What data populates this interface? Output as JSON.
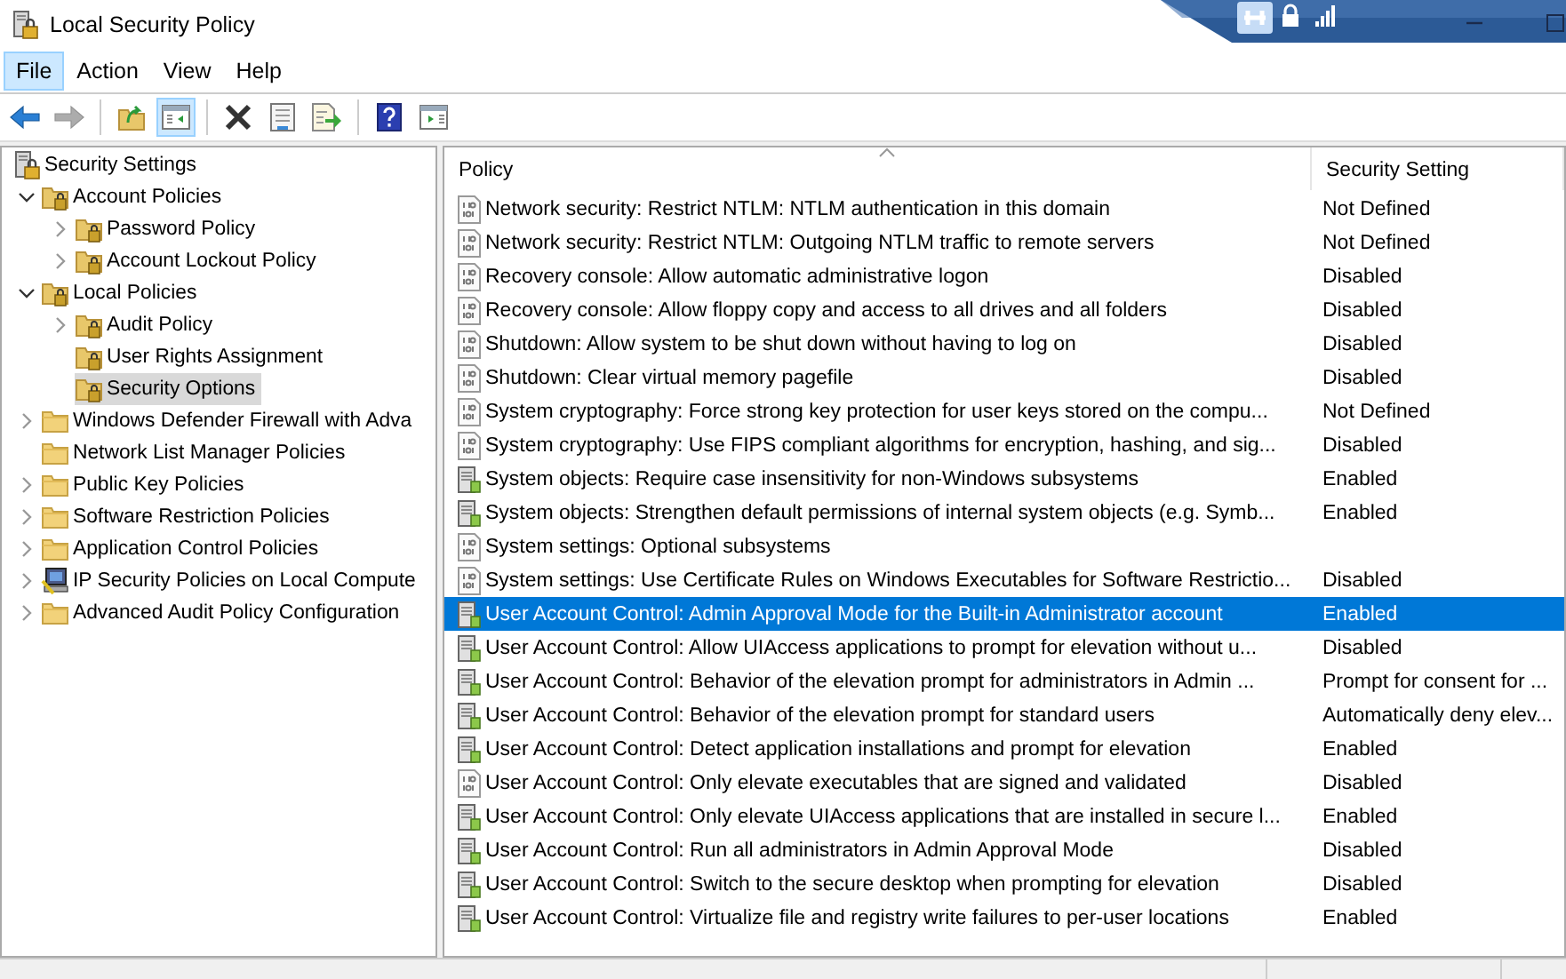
{
  "window": {
    "title": "Local Security Policy"
  },
  "menu": [
    {
      "label": "File",
      "selected": true
    },
    {
      "label": "Action",
      "selected": false
    },
    {
      "label": "View",
      "selected": false
    },
    {
      "label": "Help",
      "selected": false
    }
  ],
  "toolbar": [
    {
      "kind": "back",
      "disabled": false,
      "pressed": false
    },
    {
      "kind": "forward",
      "disabled": true,
      "pressed": false
    },
    {
      "kind": "separator"
    },
    {
      "kind": "up",
      "disabled": false,
      "pressed": false
    },
    {
      "kind": "tree",
      "disabled": false,
      "pressed": true
    },
    {
      "kind": "separator"
    },
    {
      "kind": "delete",
      "disabled": false,
      "pressed": false
    },
    {
      "kind": "properties",
      "disabled": false,
      "pressed": false
    },
    {
      "kind": "export",
      "disabled": false,
      "pressed": false
    },
    {
      "kind": "separator"
    },
    {
      "kind": "help",
      "disabled": false,
      "pressed": false
    },
    {
      "kind": "pane",
      "disabled": false,
      "pressed": false
    }
  ],
  "tree": {
    "label": "Security Settings",
    "kind": "root",
    "selected": false,
    "children": [
      {
        "label": "Account Policies",
        "kind": "lockfolder",
        "expanded": true,
        "selected": false,
        "children": [
          {
            "label": "Password Policy",
            "kind": "lockfolder",
            "expanded": false,
            "selected": false
          },
          {
            "label": "Account Lockout Policy",
            "kind": "lockfolder",
            "expanded": false,
            "selected": false
          }
        ]
      },
      {
        "label": "Local Policies",
        "kind": "lockfolder",
        "expanded": true,
        "selected": false,
        "children": [
          {
            "label": "Audit Policy",
            "kind": "lockfolder",
            "expanded": false,
            "selected": false
          },
          {
            "label": "User Rights Assignment",
            "kind": "lockfolder",
            "selected": false
          },
          {
            "label": "Security Options",
            "kind": "lockfolder",
            "selected": true
          }
        ]
      },
      {
        "label": "Windows Defender Firewall with Adva",
        "kind": "folder",
        "expanded": false,
        "selected": false
      },
      {
        "label": "Network List Manager Policies",
        "kind": "folder",
        "selected": false
      },
      {
        "label": "Public Key Policies",
        "kind": "folder",
        "expanded": false,
        "selected": false
      },
      {
        "label": "Software Restriction Policies",
        "kind": "folder",
        "expanded": false,
        "selected": false
      },
      {
        "label": "Application Control Policies",
        "kind": "folder",
        "expanded": false,
        "selected": false
      },
      {
        "label": "IP Security Policies on Local Compute",
        "kind": "computer",
        "expanded": false,
        "selected": false
      },
      {
        "label": "Advanced Audit Policy Configuration",
        "kind": "folder",
        "expanded": false,
        "selected": false
      }
    ]
  },
  "table": {
    "columns": [
      {
        "label": "Policy",
        "sorted": true
      },
      {
        "label": "Security Setting",
        "sorted": false
      }
    ],
    "rows": [
      {
        "kind": "binary",
        "selected": false,
        "policy": "Network security: Restrict NTLM: NTLM authentication in this domain",
        "setting": "Not Defined"
      },
      {
        "kind": "binary",
        "selected": false,
        "policy": "Network security: Restrict NTLM: Outgoing NTLM traffic to remote servers",
        "setting": "Not Defined"
      },
      {
        "kind": "binary",
        "selected": false,
        "policy": "Recovery console: Allow automatic administrative logon",
        "setting": "Disabled"
      },
      {
        "kind": "binary",
        "selected": false,
        "policy": "Recovery console: Allow floppy copy and access to all drives and all folders",
        "setting": "Disabled"
      },
      {
        "kind": "binary",
        "selected": false,
        "policy": "Shutdown: Allow system to be shut down without having to log on",
        "setting": "Disabled"
      },
      {
        "kind": "binary",
        "selected": false,
        "policy": "Shutdown: Clear virtual memory pagefile",
        "setting": "Disabled"
      },
      {
        "kind": "binary",
        "selected": false,
        "policy": "System cryptography: Force strong key protection for user keys stored on the compu...",
        "setting": "Not Defined"
      },
      {
        "kind": "binary",
        "selected": false,
        "policy": "System cryptography: Use FIPS compliant algorithms for encryption, hashing, and sig...",
        "setting": "Disabled"
      },
      {
        "kind": "server",
        "selected": false,
        "policy": "System objects: Require case insensitivity for non-Windows subsystems",
        "setting": "Enabled"
      },
      {
        "kind": "server",
        "selected": false,
        "policy": "System objects: Strengthen default permissions of internal system objects (e.g. Symb...",
        "setting": "Enabled"
      },
      {
        "kind": "binary",
        "selected": false,
        "policy": "System settings: Optional subsystems"
      },
      {
        "kind": "binary",
        "selected": false,
        "policy": "System settings: Use Certificate Rules on Windows Executables for Software Restrictio...",
        "setting": "Disabled"
      },
      {
        "kind": "server",
        "selected": true,
        "policy": "User Account Control: Admin Approval Mode for the Built-in Administrator account",
        "setting": "Enabled"
      },
      {
        "kind": "server",
        "selected": false,
        "policy": "User Account Control: Allow UIAccess applications to prompt for elevation without u...",
        "setting": "Disabled"
      },
      {
        "kind": "server",
        "selected": false,
        "policy": "User Account Control: Behavior of the elevation prompt for administrators in Admin ...",
        "setting": "Prompt for consent for ..."
      },
      {
        "kind": "server",
        "selected": false,
        "policy": "User Account Control: Behavior of the elevation prompt for standard users",
        "setting": "Automatically deny elev..."
      },
      {
        "kind": "server",
        "selected": false,
        "policy": "User Account Control: Detect application installations and prompt for elevation",
        "setting": "Enabled"
      },
      {
        "kind": "binary",
        "selected": false,
        "policy": "User Account Control: Only elevate executables that are signed and validated",
        "setting": "Disabled"
      },
      {
        "kind": "server",
        "selected": false,
        "policy": "User Account Control: Only elevate UIAccess applications that are installed in secure l...",
        "setting": "Enabled"
      },
      {
        "kind": "server",
        "selected": false,
        "policy": "User Account Control: Run all administrators in Admin Approval Mode",
        "setting": "Disabled"
      },
      {
        "kind": "server",
        "selected": false,
        "policy": "User Account Control: Switch to the secure desktop when prompting for elevation",
        "setting": "Disabled"
      },
      {
        "kind": "server",
        "selected": false,
        "policy": "User Account Control: Virtualize file and registry write failures to per-user locations",
        "setting": "Enabled"
      }
    ]
  }
}
